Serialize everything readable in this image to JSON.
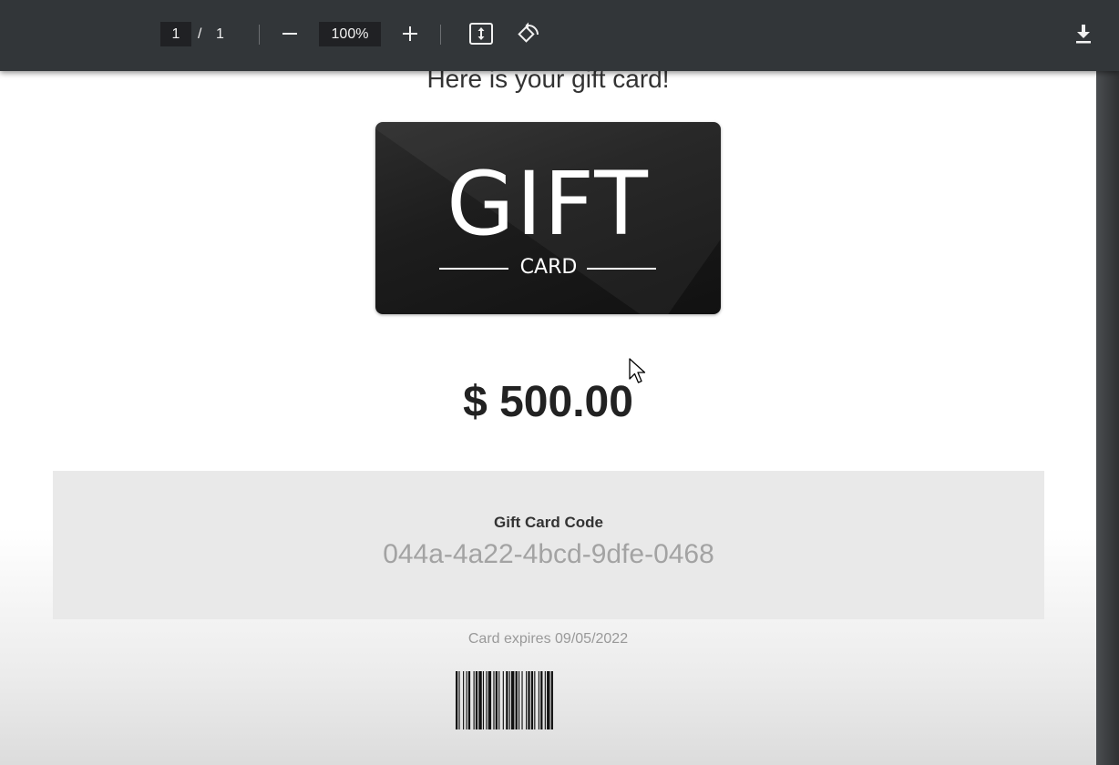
{
  "toolbar": {
    "current_page": "1",
    "page_separator": "/",
    "total_pages": "1",
    "zoom": "100%",
    "icons": [
      "zoom-out-icon",
      "zoom-in-icon",
      "fit-to-page-icon",
      "rotate-icon",
      "download-icon"
    ]
  },
  "document": {
    "headline": "Here is your gift card!",
    "card": {
      "title": "GIFT",
      "subtitle": "CARD"
    },
    "amount": "$ 500.00",
    "code_label": "Gift Card Code",
    "code_value": "044a-4a22-4bcd-9dfe-0468",
    "expires": "Card expires 09/05/2022"
  },
  "colors": {
    "toolbar_bg": "#323639",
    "input_bg": "#202124",
    "page_bg": "#ffffff",
    "card_bg": "#1d1d1d",
    "code_panel_bg": "#e9e9e9"
  }
}
